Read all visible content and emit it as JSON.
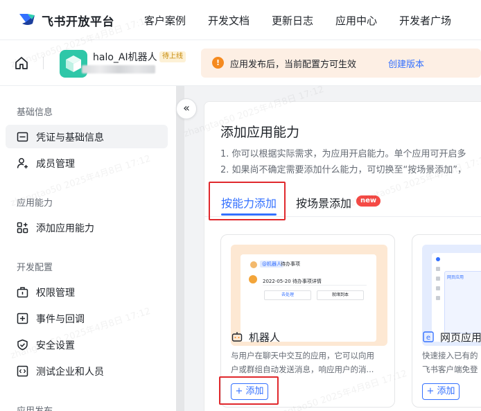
{
  "topnav": {
    "brand": "飞书开放平台",
    "links": [
      "客户案例",
      "开发文档",
      "更新日志",
      "应用中心",
      "开发者广场"
    ]
  },
  "app": {
    "name": "halo_AI机器人",
    "status": "待上线"
  },
  "notice": {
    "text": "应用发布后，当前配置方可生效",
    "action": "创建版本"
  },
  "sidebar": {
    "groups": [
      {
        "title": "基础信息",
        "items": [
          "凭证与基础信息",
          "成员管理"
        ]
      },
      {
        "title": "应用能力",
        "items": [
          "添加应用能力"
        ]
      },
      {
        "title": "开发配置",
        "items": [
          "权限管理",
          "事件与回调",
          "安全设置",
          "测试企业和人员"
        ]
      },
      {
        "title": "应用发布",
        "items": []
      }
    ]
  },
  "main": {
    "title": "添加应用能力",
    "desc1": "1. 你可以根据实际需求，为应用开启能力。单个应用可开启多",
    "desc2": "2. 如果尚不确定需要添加什么能力，可切换至“按场景添加”，",
    "tabs": [
      "按能力添加",
      "按场景添加"
    ],
    "new_badge": "new",
    "cards": [
      {
        "title": "机器人",
        "desc_line1": "与用户在聊天中交互的应用，它可以向用",
        "desc_line2": "户或群组自动发送消息，响应用户的消...",
        "add": "+ 添加",
        "mock": {
          "chat_name": "@机器人",
          "chat_tag": "待办事项",
          "date_line": "2022-05-20 待办事项详情",
          "btn1": "去处理",
          "btn2": "就绪到本"
        }
      },
      {
        "title": "网页应用",
        "desc_line1": "快速接入已有的",
        "desc_line2": "飞书客户端免登",
        "add": "+ 添加",
        "mock": {
          "label": "网页应用"
        }
      }
    ]
  },
  "watermark": "zhangtao50 2025年4月8日 17:12",
  "colors": {
    "accent": "#3370ff",
    "highlight": "#e0282c",
    "new": "#f54a45",
    "warning": "#f58a1f"
  }
}
